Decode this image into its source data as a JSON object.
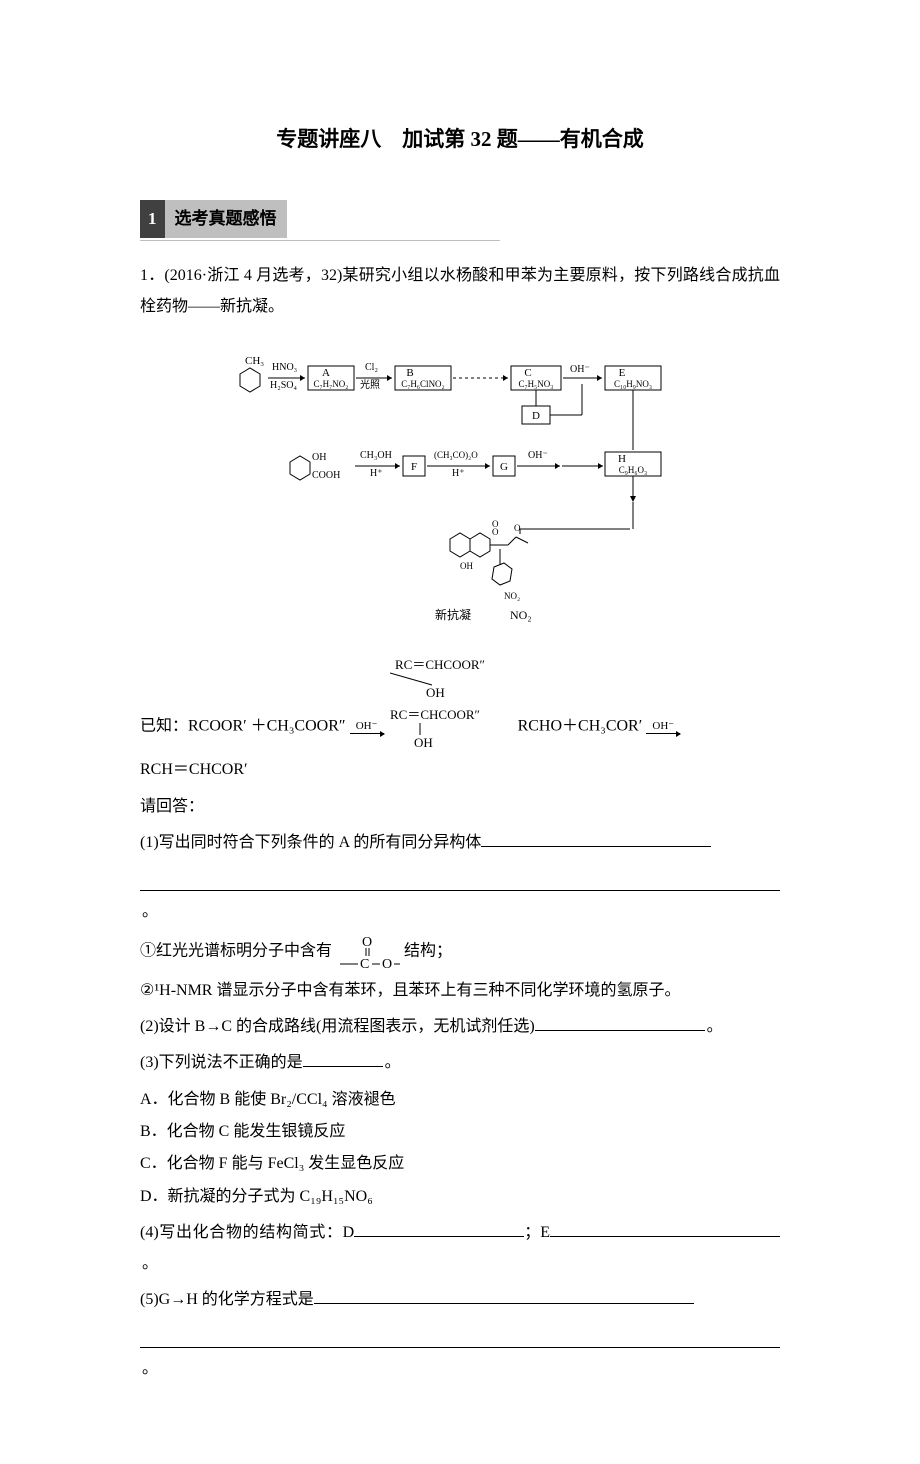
{
  "title": "专题讲座八　加试第 32 题——有机合成",
  "section": {
    "num": "1",
    "label": "选考真题感悟"
  },
  "q1": {
    "stem1": "1．(2016·浙江 4 月选考，32)某研究小组以水杨酸和甲苯为主要原料，按下列路线合成抗血栓药物——新抗凝。",
    "known_prefix": "已知：RCOOR′ ＋CH₃COOR″",
    "known_cond": "OH⁻",
    "known_mid": "　RCHO＋CH₃COR′",
    "known_cond2": "OH⁻",
    "known_tail": "RCH＝CHCOR′",
    "answer_label": "请回答：",
    "p1": "(1)写出同时符合下列条件的 A 的所有同分异构体",
    "p1_cond1": "①红光光谱标明分子中含有",
    "p1_cond1_tail": "结构；",
    "p1_cond2": "②¹H-NMR 谱显示分子中含有苯环，且苯环上有三种不同化学环境的氢原子。",
    "p2": "(2)设计 B→C 的合成路线(用流程图表示，无机试剂任选)",
    "p3": "(3)下列说法不正确的是",
    "opts": {
      "A": "A．化合物 B 能使 Br₂/CCl₄ 溶液褪色",
      "B": "B．化合物 C 能发生银镜反应",
      "C": "C．化合物 F 能与 FeCl₃ 发生显色反应",
      "D": "D．新抗凝的分子式为 C₁₉H₁₅NO₆"
    },
    "p4": "(4)写出化合物的结构简式：D",
    "p4_mid": "；E",
    "p5": "(5)G→H 的化学方程式是",
    "diagram": {
      "toluene": "CH₃",
      "r1_top": "HNO₃",
      "r1_bot": "H₂SO₄",
      "A": "A",
      "Af": "C₇H₇NO₂",
      "r2_top": "Cl₂",
      "r2_bot": "光照",
      "B": "B",
      "Bf": "C₇H₆ClNO₂",
      "C": "C",
      "Cf": "C₇H₅NO₃",
      "D": "D",
      "ohm": "OH⁻",
      "E": "E",
      "Ef": "C₁₀H₉NO₃",
      "sal_oh": "OH",
      "sal_cooh": "COOH",
      "r3_top": "CH₃OH",
      "r3_bot": "H⁺",
      "F": "F",
      "r4_top": "(CH₃CO)₂O",
      "r4_bot": "H⁺",
      "G": "G",
      "H": "H",
      "Hf": "C₉H₆O₃",
      "final": "新抗凝",
      "no2": "NO₂",
      "oh": "OH",
      "frag_top": "RC＝CHCOOR″",
      "frag_bot": "OH"
    }
  }
}
